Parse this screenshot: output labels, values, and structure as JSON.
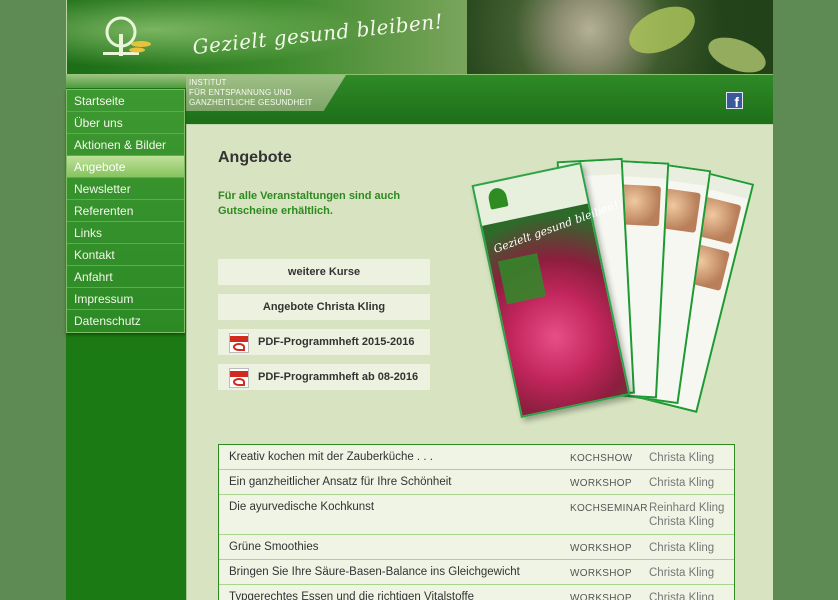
{
  "header": {
    "slogan": "Gezielt gesund bleiben!"
  },
  "institute": {
    "line1": "INSTITUT",
    "line2": "FÜR ENTSPANNUNG UND",
    "line3": "GANZHEITLICHE GESUNDHEIT"
  },
  "social": {
    "facebook_label": "f"
  },
  "nav": {
    "items": [
      {
        "label": "Startseite"
      },
      {
        "label": "Über uns"
      },
      {
        "label": "Aktionen & Bilder"
      },
      {
        "label": "Angebote"
      },
      {
        "label": "Newsletter"
      },
      {
        "label": "Referenten"
      },
      {
        "label": "Links"
      },
      {
        "label": "Kontakt"
      },
      {
        "label": "Anfahrt"
      },
      {
        "label": "Impressum"
      },
      {
        "label": "Datenschutz"
      }
    ],
    "active": "Angebote"
  },
  "main": {
    "title": "Angebote",
    "gift_note": "Für alle Veranstaltungen sind auch Gutscheine erhältlich.",
    "buttons": {
      "weitere_kurse": "weitere Kurse",
      "angebote_kling": "Angebote Christa Kling",
      "pdf1": "PDF-Programmheft 2015-2016",
      "pdf2": "PDF-Programmheft ab 08-2016"
    },
    "brochure": {
      "slogan": "Gezielt gesund bleiben!"
    },
    "events": [
      {
        "title": "Kreativ kochen mit der Zauberküche . . .",
        "type": "KOCHSHOW",
        "person": "Christa Kling"
      },
      {
        "title": "Ein ganzheitlicher Ansatz für Ihre Schönheit",
        "type": "WORKSHOP",
        "person": "Christa Kling"
      },
      {
        "title": "Die ayurvedische Kochkunst",
        "type": "KOCHSEMINAR",
        "person": "Reinhard Kling",
        "person2": "Christa Kling"
      },
      {
        "title": "Grüne Smoothies",
        "type": "WORKSHOP",
        "person": "Christa Kling"
      },
      {
        "title": "Bringen Sie Ihre Säure-Basen-Balance ins Gleichgewicht",
        "type": "WORKSHOP",
        "person": "Christa Kling"
      },
      {
        "title": "Typgerechtes Essen und die richtigen Vitalstoffe",
        "type": "WORKSHOP",
        "person": "Christa Kling"
      }
    ]
  },
  "colors": {
    "page_bg": "#5e8a53",
    "sidebar_green": "#1b7a14",
    "accent_green": "#2d8a1f",
    "content_bg": "#d8e4c1"
  }
}
